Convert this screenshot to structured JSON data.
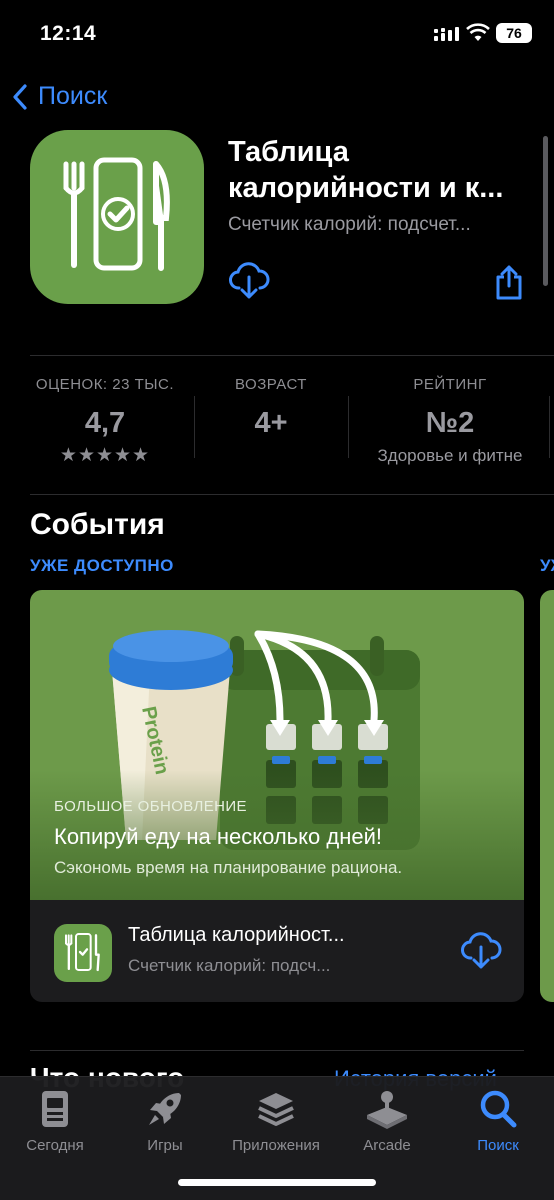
{
  "status_bar": {
    "time": "12:14",
    "battery": "76"
  },
  "nav": {
    "back_label": "Поиск"
  },
  "app": {
    "title_line1": "Таблица",
    "title_line2": "калорийности и к...",
    "subtitle": "Счетчик калорий: подсчет...",
    "icon": "fork-phone-check-knife-icon",
    "brand_color": "#6aa04a"
  },
  "stats": {
    "ratings": {
      "label": "ОЦЕНОК: 23 ТЫС.",
      "value": "4,7",
      "stars": "★★★★★"
    },
    "age": {
      "label": "ВОЗРАСТ",
      "value": "4+"
    },
    "rank": {
      "label": "РЕЙТИНГ",
      "value": "№2",
      "sub": "Здоровье и фитне"
    }
  },
  "events": {
    "title": "События",
    "tag": "УЖЕ ДОСТУПНО",
    "tag_peek": "УЖ",
    "card": {
      "kind": "БОЛЬШОЕ ОБНОВЛЕНИЕ",
      "title": "Копируй еду на несколько дней!",
      "description": "Сэкономь время на планирование рациона.",
      "hero_text": "Protein",
      "app_title": "Таблица калорийност...",
      "app_subtitle": "Счетчик калорий: подсч..."
    }
  },
  "next_section": {
    "title": "Что нового",
    "link": "История версий"
  },
  "tabs": [
    {
      "label": "Сегодня",
      "icon": "today-icon"
    },
    {
      "label": "Игры",
      "icon": "rocket-icon"
    },
    {
      "label": "Приложения",
      "icon": "apps-stack-icon"
    },
    {
      "label": "Arcade",
      "icon": "joystick-icon"
    },
    {
      "label": "Поиск",
      "icon": "search-icon",
      "active": true
    }
  ],
  "colors": {
    "accent": "#3d8bfd",
    "background": "#000000"
  }
}
